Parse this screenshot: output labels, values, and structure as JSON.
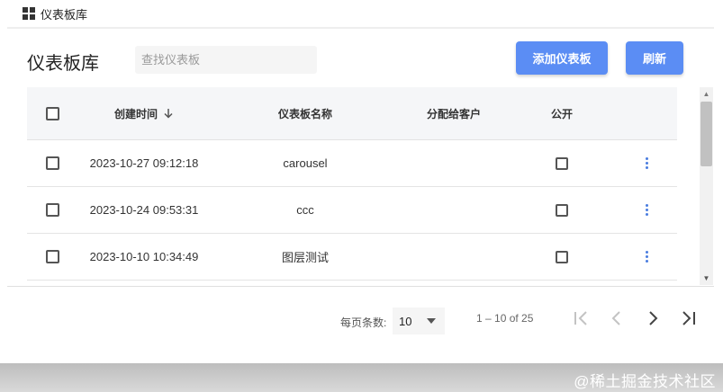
{
  "breadcrumb": {
    "label": "仪表板库"
  },
  "header": {
    "title": "仪表板库",
    "search_placeholder": "查找仪表板",
    "add_label": "添加仪表板",
    "refresh_label": "刷新"
  },
  "table": {
    "columns": {
      "created": "创建时间",
      "name": "仪表板名称",
      "customer": "分配给客户",
      "public": "公开"
    },
    "sort": "descending",
    "rows": [
      {
        "created": "2023-10-27 09:12:18",
        "name": "carousel",
        "customer": "",
        "public": false
      },
      {
        "created": "2023-10-24 09:53:31",
        "name": "ccc",
        "customer": "",
        "public": false
      },
      {
        "created": "2023-10-10 10:34:49",
        "name": "图层测试",
        "customer": "",
        "public": false
      }
    ]
  },
  "pagination": {
    "page_size_label": "每页条数:",
    "page_size": "10",
    "range": "1 – 10 of 25"
  },
  "watermark": "@稀土掘金技术社区",
  "colors": {
    "accent": "#5b8df4",
    "kebab": "#4a7de0",
    "header_bg": "#f5f6f8"
  },
  "icons": [
    "dashboard-icon",
    "sort-down-icon",
    "kebab-icon",
    "first-page-icon",
    "prev-page-icon",
    "next-page-icon",
    "last-page-icon"
  ]
}
